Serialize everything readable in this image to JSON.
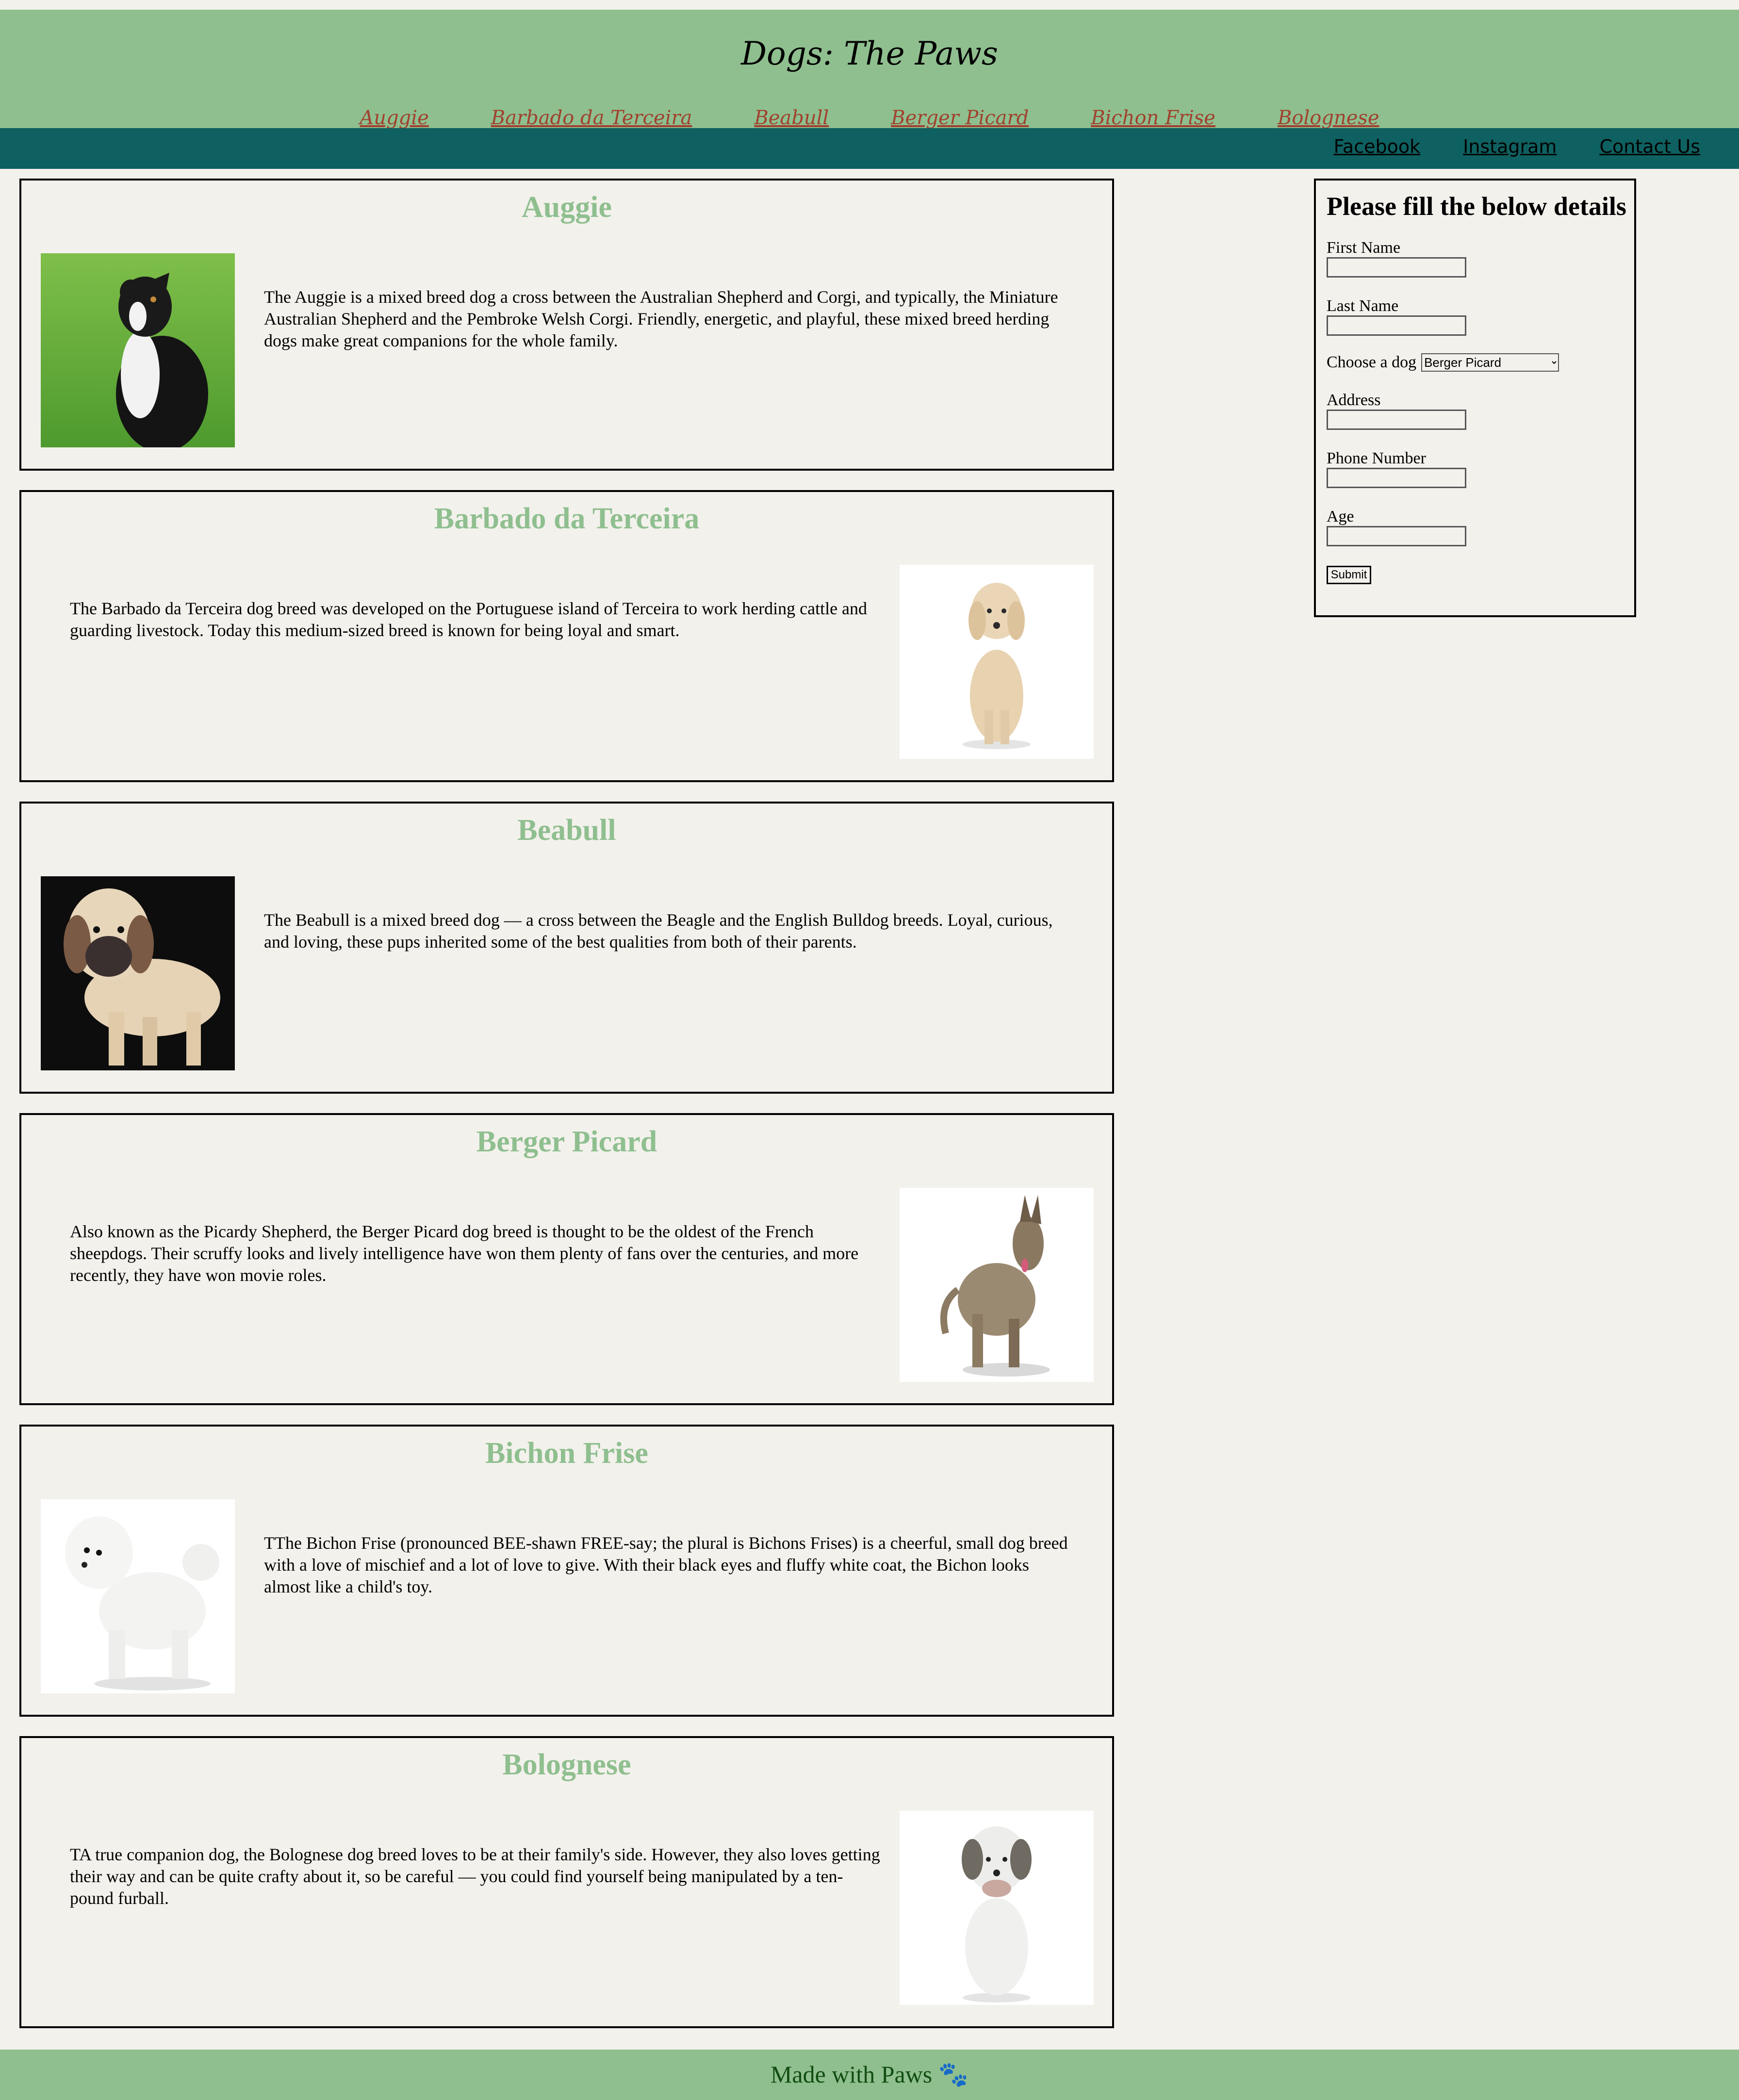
{
  "header": {
    "title": "Dogs: The Paws",
    "nav": [
      "Auggie",
      "Barbado da Terceira",
      "Beabull",
      "Berger Picard",
      "Bichon Frise",
      "Bolognese"
    ]
  },
  "social": [
    "Facebook",
    "Instagram",
    "Contact Us"
  ],
  "cards": [
    {
      "title": "Auggie",
      "text": "The Auggie is a mixed breed dog a cross between the Australian Shepherd and Corgi, and typically, the Miniature Australian Shepherd and the Pembroke Welsh Corgi. Friendly, energetic, and playful, these mixed breed herding dogs make great companions for the whole family."
    },
    {
      "title": "Barbado da Terceira",
      "text": "The Barbado da Terceira dog breed was developed on the Portuguese island of Terceira to work herding cattle and guarding livestock. Today this medium-sized breed is known for being loyal and smart."
    },
    {
      "title": "Beabull",
      "text": "The Beabull is a mixed breed dog — a cross between the Beagle and the English Bulldog breeds. Loyal, curious, and loving, these pups inherited some of the best qualities from both of their parents."
    },
    {
      "title": "Berger Picard",
      "text": "Also known as the Picardy Shepherd, the Berger Picard dog breed is thought to be the oldest of the French sheepdogs. Their scruffy looks and lively intelligence have won them plenty of fans over the centuries, and more recently, they have won movie roles."
    },
    {
      "title": "Bichon Frise",
      "text": "TThe Bichon Frise (pronounced BEE-shawn FREE-say; the plural is Bichons Frises) is a cheerful, small dog breed with a love of mischief and a lot of love to give. With their black eyes and fluffy white coat, the Bichon looks almost like a child's toy."
    },
    {
      "title": "Bolognese",
      "text": "TA true companion dog, the Bolognese dog breed loves to be at their family's side. However, they also loves getting their way and can be quite crafty about it, so be careful — you could find yourself being manipulated by a ten-pound furball."
    }
  ],
  "form": {
    "heading": "Please fill the below details",
    "first_name_label": "First Name",
    "last_name_label": "Last Name",
    "choose_label": "Choose a dog",
    "selected_dog": "Berger Picard",
    "address_label": "Address",
    "phone_label": "Phone Number",
    "age_label": "Age",
    "submit_label": "Submit"
  },
  "footer": {
    "text": "Made with Paws 🐾"
  }
}
